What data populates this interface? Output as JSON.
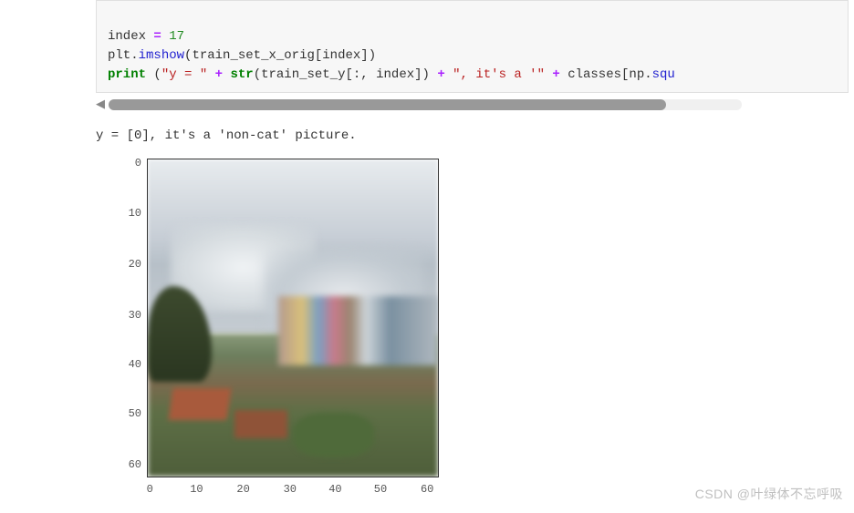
{
  "code": {
    "line1_var": "index",
    "line1_op": " = ",
    "line1_num": "17",
    "line2_a": "plt",
    "line2_dot1": ".",
    "line2_func": "imshow",
    "line2_open": "(",
    "line2_arg": "train_set_x_orig[index]",
    "line2_close": ")",
    "line3_print": "print",
    "line3_sp": " (",
    "line3_str1": "\"y = \"",
    "line3_plus1": " + ",
    "line3_str_fn": "str",
    "line3_str_arg_open": "(",
    "line3_str_arg": "train_set_y[:, index]",
    "line3_str_arg_close": ")",
    "line3_plus2": " + ",
    "line3_str2": "\", it's a '\"",
    "line3_plus3": " + ",
    "line3_tail": "classes[np",
    "line3_tail_dot": ".",
    "line3_tail_fn": "squ"
  },
  "output": {
    "text": "y = [0], it's a 'non-cat' picture."
  },
  "watermark": "CSDN @叶绿体不忘呼吸",
  "chart_data": {
    "type": "heatmap",
    "title": "",
    "xlabel": "",
    "ylabel": "",
    "x_ticks": [
      0,
      10,
      20,
      30,
      40,
      50,
      60
    ],
    "y_ticks": [
      0,
      10,
      20,
      30,
      40,
      50,
      60
    ],
    "xlim": [
      0,
      63
    ],
    "ylim": [
      63,
      0
    ],
    "description": "64x64 RGB image displayed via plt.imshow; content is a pixelated photograph of a cloudy sky over low buildings and greenery (non-cat image).",
    "values": null
  }
}
